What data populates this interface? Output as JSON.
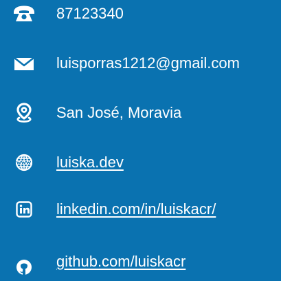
{
  "contact": {
    "phone": {
      "icon": "phone-icon",
      "text": "87123340"
    },
    "email": {
      "icon": "envelope-icon",
      "text": "luisporras1212@gmail.com"
    },
    "location": {
      "icon": "location-pin-icon",
      "text": "San José, Moravia"
    },
    "website": {
      "icon": "globe-www-icon",
      "text": "luiska.dev"
    },
    "linkedin": {
      "icon": "linkedin-icon",
      "text": "linkedin.com/in/luiskacr/"
    },
    "github": {
      "icon": "github-icon",
      "text": "github.com/luiskacr"
    }
  },
  "colors": {
    "background": "#0a72b0",
    "foreground": "#ffffff"
  }
}
